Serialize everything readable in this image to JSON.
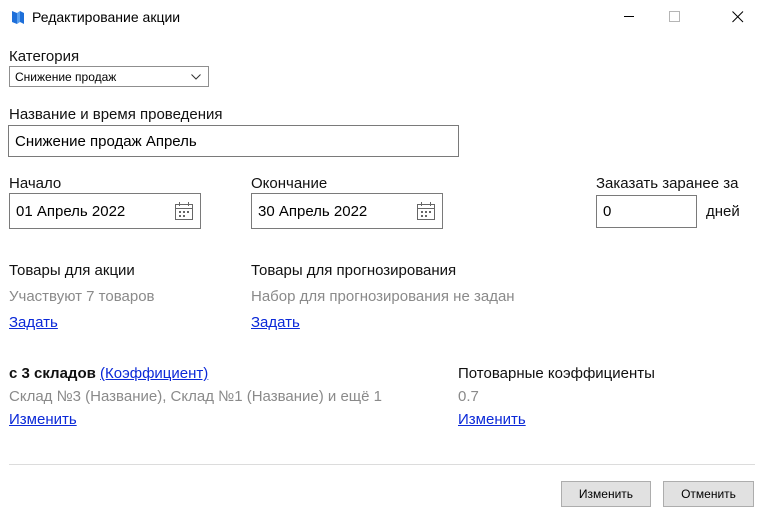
{
  "window": {
    "title": "Редактирование акции",
    "minimize_icon": "minimize-icon",
    "maximize_icon": "maximize-icon",
    "close_icon": "close-icon"
  },
  "category": {
    "label": "Категория",
    "selected": "Снижение продаж"
  },
  "name_time": {
    "label": "Название и время проведения",
    "value": "Снижение продаж Апрель"
  },
  "start": {
    "label": "Начало",
    "value": "01 Апрель 2022"
  },
  "end": {
    "label": "Окончание",
    "value": "30 Апрель 2022"
  },
  "order_ahead": {
    "label": "Заказать заранее за",
    "value": "0",
    "unit": "дней"
  },
  "promo_goods": {
    "label": "Товары для акции",
    "status": "Участвуют 7 товаров",
    "link": "Задать"
  },
  "forecast_goods": {
    "label": "Товары для прогнозирования",
    "status": "Набор для прогнозирования не задан",
    "link": "Задать"
  },
  "warehouses": {
    "label": "с 3 складов",
    "coef_link": "(Коэффициент)",
    "list": "Склад №3 (Название), Склад №1 (Название) и ещё 1",
    "link": "Изменить"
  },
  "item_coefficients": {
    "label": "Потоварные коэффициенты",
    "value": "0.7",
    "link": "Изменить"
  },
  "buttons": {
    "apply": "Изменить",
    "cancel": "Отменить"
  }
}
